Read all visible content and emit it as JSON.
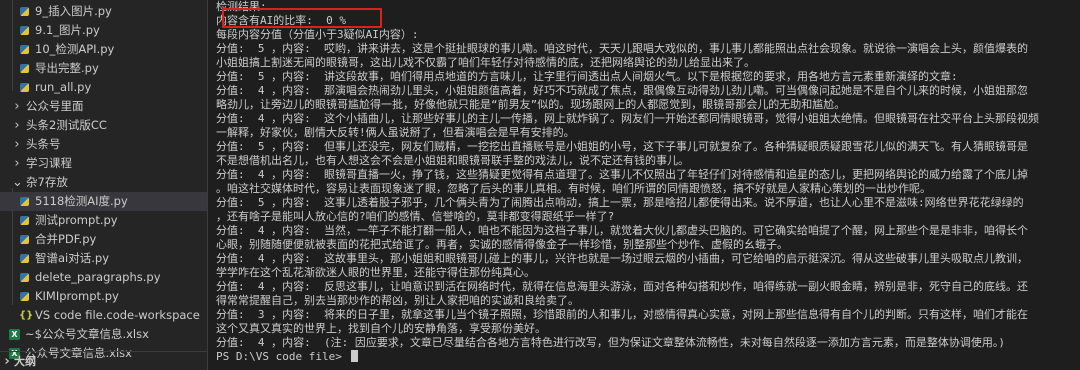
{
  "explorer": {
    "items": [
      {
        "label": "9_插入图片.py",
        "kind": "py",
        "depth": 2
      },
      {
        "label": "9.1_图片.py",
        "kind": "py",
        "depth": 2
      },
      {
        "label": "10_检测API.py",
        "kind": "py",
        "depth": 2
      },
      {
        "label": "导出完整.py",
        "kind": "py",
        "depth": 2
      },
      {
        "label": "run_all.py",
        "kind": "py",
        "depth": 2
      },
      {
        "label": "公众号里面",
        "kind": "folder",
        "depth": 1
      },
      {
        "label": "头条2测试版CC",
        "kind": "folder",
        "depth": 1
      },
      {
        "label": "头条号",
        "kind": "folder",
        "depth": 1
      },
      {
        "label": "学习课程",
        "kind": "folder",
        "depth": 1
      },
      {
        "label": "杂7存放",
        "kind": "folder-open",
        "depth": 1
      },
      {
        "label": "5118检测AI度.py",
        "kind": "py",
        "depth": 2,
        "selected": true
      },
      {
        "label": "测试prompt.py",
        "kind": "py",
        "depth": 2
      },
      {
        "label": "合并PDF.py",
        "kind": "py",
        "depth": 2
      },
      {
        "label": "智谱ai对话.py",
        "kind": "py",
        "depth": 2
      },
      {
        "label": "delete_paragraphs.py",
        "kind": "py",
        "depth": 2
      },
      {
        "label": "KIMIprompt.py",
        "kind": "py",
        "depth": 2
      },
      {
        "label": "VS code file.code-workspace",
        "kind": "json",
        "depth": 1
      },
      {
        "label": "~$公众号文章信息.xlsx",
        "kind": "xlsx",
        "depth": 0
      },
      {
        "label": "公众号文章信息.xlsx",
        "kind": "xlsx",
        "depth": 0
      }
    ],
    "section_label": "大纲"
  },
  "terminal": {
    "lines": [
      "检测结果:",
      "内容含有AI的比率:  0 %",
      "每段内容分值（分值小于3疑似AI内容）:",
      "分值:  5 ，内容:  哎哟，讲来讲去，这是个挺扯眼球的事儿嘞。咱这时代，天天儿跟唱大戏似的，事儿事儿都能照出点社会现象。就说徐一演唱会上头，颜值爆表的",
      "小姐姐搞上割迷无闻的眼镜哥，这出儿戏不仅霸了咱们年轻仔对待感情的底，还把网络舆论的劲儿给显出来了。",
      "分值:  5 ，内容:  讲这段故事，咱们得用点地道的方言味儿，让字里行间透出点人间烟火气。以下是根据您的要求，用各地方言元素重新演绎的文章:",
      "分值:  4 ，内容:  那演唱会热闹劲儿里头，小姐姐颜值高着，好巧不巧就成了焦点，跟偶像互动得劲儿劲儿嘞。可当偶像问起她是不是自个儿来的时候，小姐姐那忽",
      "略劲儿，让旁边儿的眼镜哥尴尬得一批，好像他就只能是“前男友”似的。现场跟网上的人都愿觉到，眼镜哥那会儿的无助和尴尬。",
      "分值:  4 ，内容:  这个小插曲儿，让那些好事儿的主儿一传播，网上就炸锅了。网友们一开始还都同情眼镜哥，觉得小姐姐太绝情。但眼镜哥在社交平台上头那段视频",
      "一解释，好家伙，剧情大反转!俩人虽说掰了，但看演唱会是早有安排的。",
      "分值:  5 ，内容:  但事儿还没完，网友们贼精，一挖挖出直播账号是小姐姐的小号，这下子事儿可就复杂了。各种猜疑眼质疑跟雪花儿似的满天飞。有人猜眼镜哥是",
      "不是想借机出名儿，也有人想这会不会是小姐姐和眼镜哥联手整的戏法儿，说不定还有钱的事儿。",
      "分值:  4 ，内容:  眼镜哥直播一火，挣了钱，这些猜疑更觉得有点道理了。这事儿不仅照出了年轻仔们对待感情和追星的态儿，更把网络舆论的威力给露了个底儿掉",
      "。咱这社交媒体时代，容易让表面现象迷了眼，忽略了后头的事儿真相。有时候，咱们所谓的同情跟愤怒，搞不好就是人家精心策划的一出炒作呢。",
      "分值:  5 ，内容:  这事儿透着股子邪乎，几个俩头青为了闹腾出点响动，搞上一票，那是啥招儿都使得出来。说不厚道，也让人心里不是滋味:网络世界花花绿绿的",
      "，还有啥子是能叫人放心信的?咱们的感情、信誉啥的，莫非都变得跟纸乎一样了?",
      "分值:  4 ，内容:  当然，一竿子不能打翻一船人，咱也不能因为这档子事儿，就觉着大伙儿都虚头巴脑的。可它确实给咱提了个醒，网上那些个是是非非，咱得长个",
      "心眼，别随随便便就被表面的花把式给诓了。再者，实诚的感情得像金子一样珍惜，别整那些个炒作、虚假的幺蛾子。",
      "分值:  4 ，内容:  这故事里头，那小姐姐和眼镜哥儿碰上的事儿，兴许也就是一场过眼云烟的小插曲，可它给咱的启示挺深沉。得从这些破事儿里头吸取点儿教训，",
      "学学咋在这个乱花渐欲迷人眼的世界里，还能守得住那份纯真心。",
      "分值:  4 ，内容:  反思这事儿，让咱意识到活在网络时代，就得在信息海里头游泳，面对各种勾搭和炒作，咱得练就一副火眼金睛，辨别是非，死守自己的底线。还",
      "得常常提醒自己，别去当那炒作的帮凶，别让人家把咱的实诚和良给卖了。",
      "分值:  3 ，内容:  将来的日子里，就拿这事儿当个镜子照照，珍惜跟前的人和事儿，对感情得真心实意，对网上那些信息得有自个儿的判断。只有这样，咱们才能在",
      "这个又真又真实的世界上，找到自个儿的安静角落，享受那份美好。",
      "分值:  4 ，内容:  (注: 因应要求，文章已尽量结合各地方言特色进行改写，但为保证文章整体流畅性，未对每自然段逐一添加方言元素，而是整体协调使用。)",
      "PS D:\\VS code file> "
    ]
  }
}
